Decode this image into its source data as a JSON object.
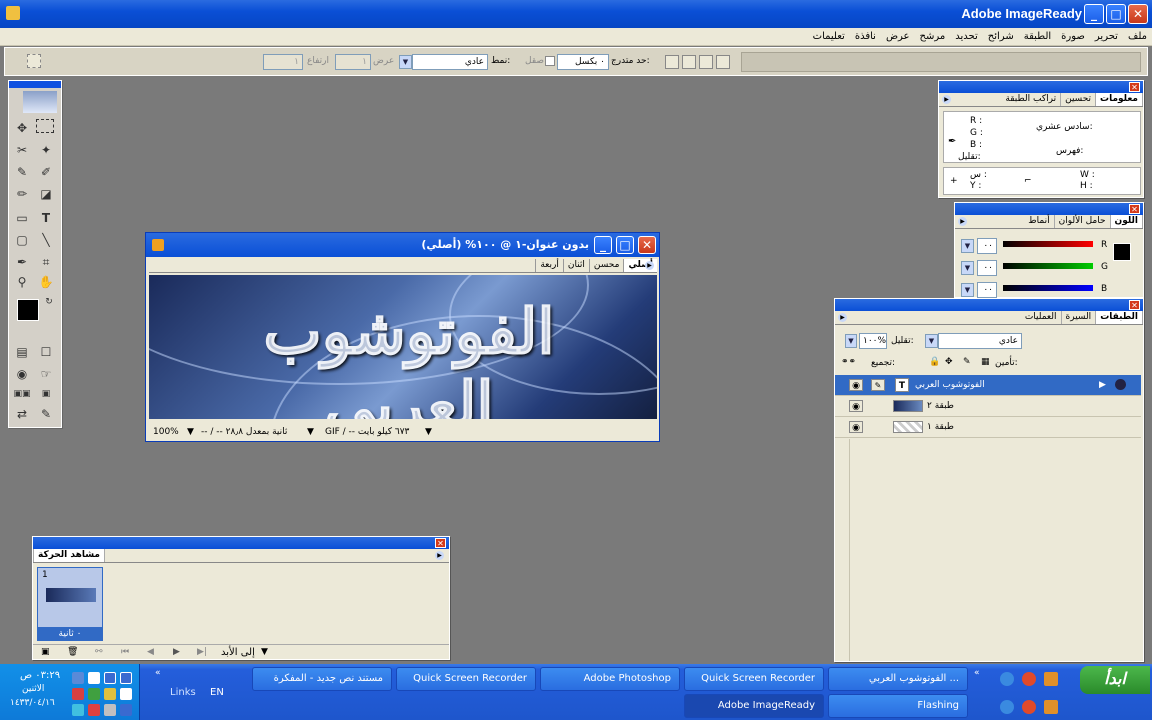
{
  "app": {
    "title": "Adobe ImageReady"
  },
  "menu": [
    "ملف",
    "تحرير",
    "صورة",
    "الطبقة",
    "شرائح",
    "تحديد",
    "مرشح",
    "عرض",
    "نافذة",
    "تعليمات"
  ],
  "options": {
    "feather_label": "حد متدرج:",
    "feather_value": "٠ بكسل",
    "antialias_label": "صقل",
    "style_label": "نمط:",
    "style_value": "عادي",
    "width_label": "عرض",
    "width_value": "١",
    "height_label": "ارتفاع",
    "height_value": "١"
  },
  "info_panel": {
    "tabs": [
      "معلومات",
      "تحسين",
      "تراكب الطبقة"
    ],
    "r": "R :",
    "g": "G :",
    "b": "B :",
    "opacity": "تقليل:",
    "hex": "سادس عشري:",
    "index": "فهرس:",
    "x": "س :",
    "y": "Y :",
    "w": "W :",
    "h": "H :"
  },
  "color_panel": {
    "tabs": [
      "اللون",
      "حامل الألوان",
      "أنماط"
    ],
    "r_val": "٠٠",
    "g_val": "٠٠",
    "b_val": "٠٠",
    "r": "R",
    "g": "G",
    "b": "B"
  },
  "document": {
    "title": "بدون عنوان-١ @ ١٠٠% (أصلي)",
    "tabs": [
      "أصلي",
      "محسن",
      "اثنان",
      "أربعة"
    ],
    "artwork_text": "الفوتوشوب العربي",
    "zoom": "100%",
    "rate": "-- / -- ثانية بمعدل ٢٨٫٨",
    "size": "GIF / -- ٦٧٣ كيلو بايت"
  },
  "layers_panel": {
    "tabs": [
      "الطبقات",
      "السيرة",
      "العمليات"
    ],
    "blend": "عادي",
    "opacity_label": "تقليل:",
    "opacity_value": "١٠٠%",
    "lock_label": "تأمين:",
    "unify_label": "تجميع:",
    "layers": [
      {
        "name": "الفوتوشوب العربي",
        "type": "T",
        "selected": true
      },
      {
        "name": "طبقة ٢",
        "selected": false
      },
      {
        "name": "طبقة ١",
        "selected": false
      }
    ]
  },
  "animation_panel": {
    "title": "مشاهد الحركة",
    "frame_number": "1",
    "frame_time": "٠ ثانية",
    "loop": "إلى الأبد"
  },
  "taskbar": {
    "start": "ابدأ",
    "row1": [
      "الفوتوشوب العربي ...",
      "Quick Screen Recorder",
      "Adobe Photoshop",
      "Quick Screen Recorder",
      "مستند نص جديد - المفكرة"
    ],
    "row2": [
      "Flashing",
      "Adobe ImageReady"
    ],
    "lang": "EN",
    "links": "Links",
    "clock_time": "٠٣:٢٩ ص",
    "clock_day": "الاثنين",
    "clock_date": "١٤٣٣/٠٤/١٦"
  }
}
